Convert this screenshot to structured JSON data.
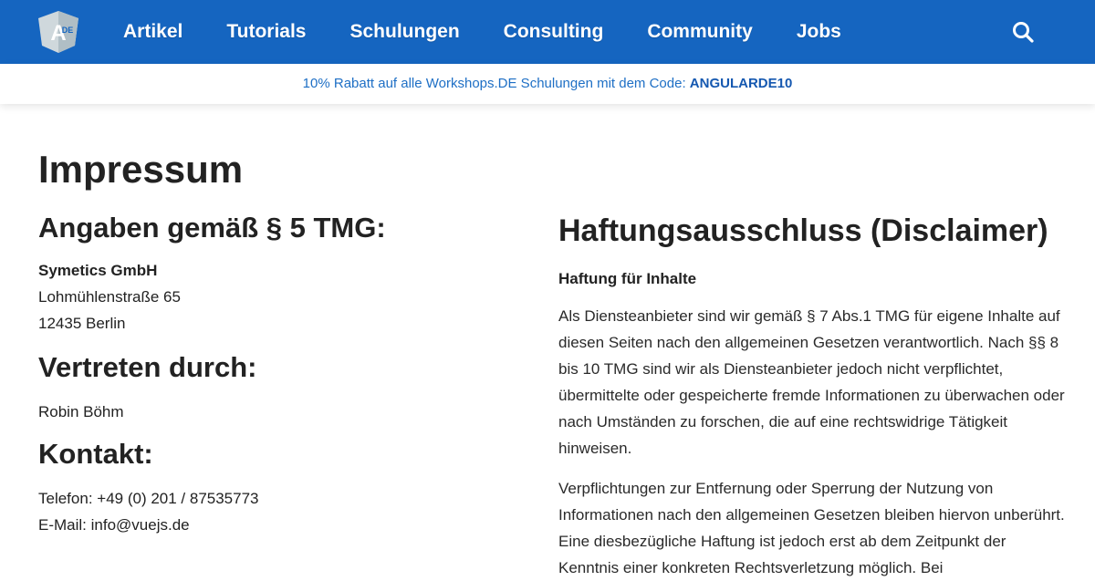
{
  "nav": {
    "logo_alt": "ADE",
    "items": [
      {
        "label": "Artikel"
      },
      {
        "label": "Tutorials"
      },
      {
        "label": "Schulungen"
      },
      {
        "label": "Consulting"
      },
      {
        "label": "Community"
      },
      {
        "label": "Jobs"
      }
    ],
    "search_icon": "search-icon"
  },
  "promo": {
    "text": "10% Rabatt auf alle Workshops.DE Schulungen mit dem Code: ",
    "code": "ANGULARDE10"
  },
  "page": {
    "title": "Impressum"
  },
  "left": {
    "angaben_heading": "Angaben gemäß § 5 TMG:",
    "company": "Symetics GmbH",
    "street": "Lohmühlenstraße 65",
    "city": "12435 Berlin",
    "vertreten_heading": "Vertreten durch:",
    "representative": "Robin Böhm",
    "kontakt_heading": "Kontakt:",
    "telefon": "Telefon: +49 (0) 201 / 87535773",
    "email": "E-Mail: info@vuejs.de"
  },
  "right": {
    "heading": "Haftungsausschluss (Disclaimer)",
    "subheading": "Haftung für Inhalte",
    "para1": "Als Diensteanbieter sind wir gemäß § 7 Abs.1 TMG für eigene Inhalte auf diesen Seiten nach den allgemeinen Gesetzen verantwortlich. Nach §§ 8 bis 10 TMG sind wir als Diensteanbieter jedoch nicht verpflichtet, übermittelte oder gespeicherte fremde Informationen zu überwachen oder nach Umständen zu forschen, die auf eine rechtswidrige Tätigkeit hinweisen.",
    "para2": "Verpflichtungen zur Entfernung oder Sperrung der Nutzung von Informationen nach den allgemeinen Gesetzen bleiben hiervon unberührt. Eine diesbezügliche Haftung ist jedoch erst ab dem Zeitpunkt der Kenntnis einer konkreten Rechtsverletzung möglich. Bei"
  },
  "colors": {
    "nav_bg": "#1565c0",
    "promo_text": "#1e6fc5",
    "logo_shield": "#b0bec5"
  }
}
